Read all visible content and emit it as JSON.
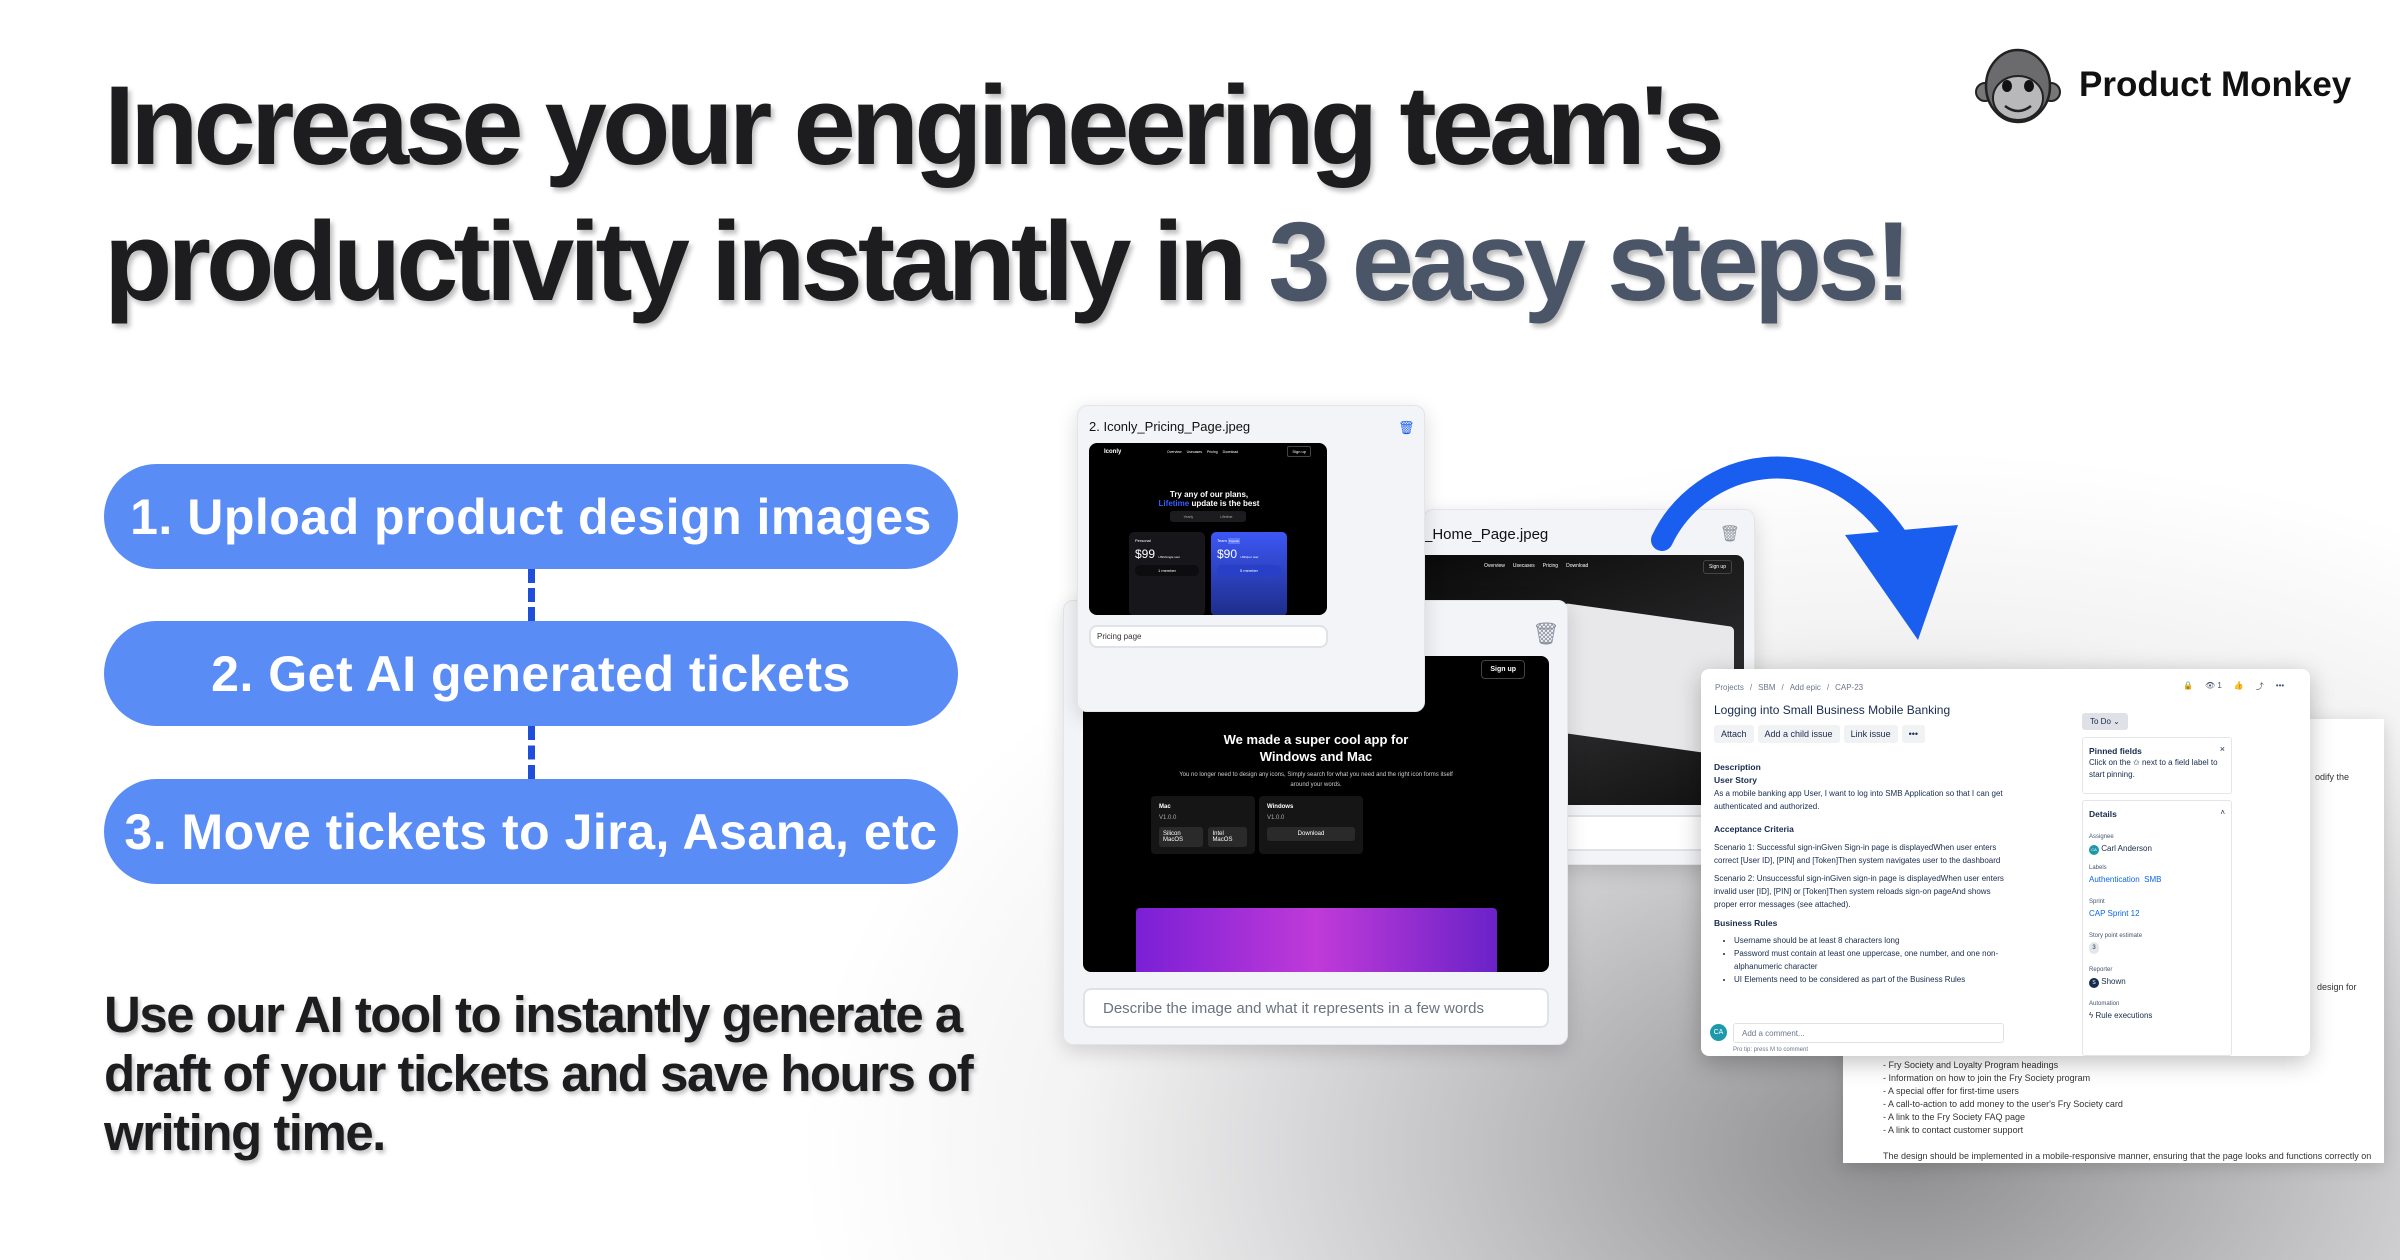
{
  "headline": {
    "line1": "Increase your engineering team's",
    "line2_pre": "productivity instantly in ",
    "line2_highlight": "3 easy steps!"
  },
  "brand": {
    "name": "Product Monkey",
    "logo_icon": "monkey-face-icon"
  },
  "steps": [
    {
      "label": "1. Upload product design images"
    },
    {
      "label": "2. Get AI generated tickets"
    },
    {
      "label": "3. Move tickets to Jira, Asana, etc"
    }
  ],
  "body_text": "Use our AI tool to instantly generate a draft of your tickets and save hours of writing time.",
  "colors": {
    "pill": "#5a8cf6",
    "connector": "#1f4fd8",
    "arrow": "#1a5ef0",
    "highlight": "#4a5568"
  },
  "uploads": {
    "pricing": {
      "filename": "2. Iconly_Pricing_Page.jpeg",
      "caption": "Pricing page",
      "shot": {
        "brand": "Iconly",
        "nav": [
          "Overview",
          "Usecases",
          "Pricing",
          "Download"
        ],
        "signup": "Sign up",
        "title1": "Try any of our plans,",
        "title_accent": "Lifetime",
        "title2": " update is the best",
        "toggle": [
          "Yearly",
          "Lifetime"
        ],
        "plans": [
          {
            "name": "Personal",
            "price": "$99",
            "unit": "USD/single user",
            "seats": "1 member"
          },
          {
            "name": "Team",
            "badge": "Popular",
            "price": "$90",
            "unit": "USD/per user",
            "seats": "5 member"
          }
        ]
      }
    },
    "home": {
      "filename_partial": "_Home_Page.jpeg",
      "placeholder_partial": "esents in a few words",
      "nav": [
        "Overview",
        "Usecases",
        "Pricing",
        "Download"
      ],
      "signup": "Sign up"
    },
    "front": {
      "placeholder": "Describe the image and what it represents in a few words",
      "shot": {
        "signup": "Sign up",
        "title": "We made a super cool app for Windows and Mac",
        "sub": "You no longer need to design any icons, Simply search for what you need and the right icon forms itself around your words.",
        "mac": {
          "name": "Mac",
          "version": "V1.0.0",
          "buttons": [
            "Silicon MacOS",
            "Intel MacOS"
          ]
        },
        "windows": {
          "name": "Windows",
          "version": "V1.0.0",
          "button": "Download"
        }
      }
    }
  },
  "jira": {
    "breadcrumb": [
      "Projects",
      "SBM",
      "Add epic",
      "CAP-23"
    ],
    "watchers": "1",
    "title": "Logging into Small Business Mobile Banking",
    "actions": [
      "Attach",
      "Add a child issue",
      "Link issue"
    ],
    "status": "To Do",
    "description_label": "Description",
    "user_story_label": "User Story",
    "user_story": "As a mobile banking app User, I want to log into SMB Application so that I can get authenticated and authorized.",
    "ac_label": "Acceptance Criteria",
    "scenario1": "Scenario 1: Successful sign-inGiven Sign-in page is displayedWhen user enters correct [User ID], [PIN] and [Token]Then system navigates user to the dashboard",
    "scenario2": "Scenario 2: Unsuccessful sign-inGiven sign-in page is displayedWhen user enters invalid user [ID], [PIN] or [Token]Then system reloads sign-on pageAnd shows proper error messages (see attached).",
    "rules_label": "Business Rules",
    "rules": [
      "Username should be at least 8 characters long",
      "Password must contain at least one uppercase, one number, and one non-alphanumeric character",
      "UI Elements need to be considered as part of the Business Rules"
    ],
    "comment_avatar": "CA",
    "comment_placeholder": "Add a comment...",
    "pro_tip": "Pro tip: press M to comment",
    "pinned_title": "Pinned fields",
    "pinned_text": "Click on the ✩ next to a field label to start pinning.",
    "details_title": "Details",
    "assignee_label": "Assignee",
    "assignee": "Carl Anderson",
    "assignee_initials": "CA",
    "labels_label": "Labels",
    "labels": [
      "Authentication",
      "SMB"
    ],
    "sprint_label": "Sprint",
    "sprint": "CAP Sprint 12",
    "estimate_label": "Story point estimate",
    "estimate": "3",
    "reporter_label": "Reporter",
    "reporter": "Shown",
    "reporter_initial": "S",
    "automation_label": "Automation",
    "automation": "Rule executions"
  },
  "background_doc": {
    "lines": [
      "- Fry Society and Loyalty Program headings",
      "- Information on how to join the Fry Society program",
      "- A special offer for first-time users",
      "- A call-to-action to add money to the user's Fry Society card",
      "- A link to the Fry Society FAQ page",
      "- A link to contact customer support"
    ],
    "footer": "The design should be implemented in a mobile-responsive manner, ensuring that the page looks and functions correctly on",
    "side_partials": [
      "odify the",
      "design for"
    ]
  }
}
